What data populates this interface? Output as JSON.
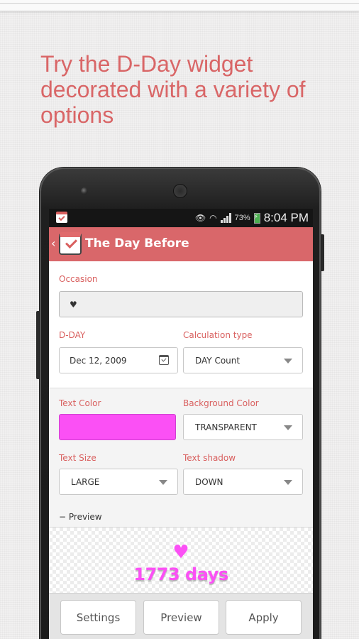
{
  "promo": {
    "headline": "Try the D-Day widget decorated with a variety of options"
  },
  "statusbar": {
    "battery_percent": "73%",
    "time": "8:04 PM"
  },
  "appbar": {
    "back_glyph": "‹",
    "title": "The Day Before"
  },
  "form": {
    "occasion": {
      "label": "Occasion",
      "value": "♥"
    },
    "dday": {
      "label": "D-DAY",
      "value": "Dec 12, 2009"
    },
    "calculation_type": {
      "label": "Calculation type",
      "value": "DAY Count"
    },
    "text_color": {
      "label": "Text Color",
      "value": "#fb50f5"
    },
    "background_color": {
      "label": "Background Color",
      "value": "TRANSPARENT"
    },
    "text_size": {
      "label": "Text Size",
      "value": "LARGE"
    },
    "text_shadow": {
      "label": "Text shadow",
      "value": "DOWN"
    },
    "preview_toggle": "− Preview"
  },
  "preview": {
    "heart": "♥",
    "days_text": "1773 days",
    "color": "#fb50f5"
  },
  "buttons": {
    "settings": "Settings",
    "preview": "Preview",
    "apply": "Apply"
  },
  "colors": {
    "accent": "#d9676a",
    "label": "#d9605f"
  }
}
